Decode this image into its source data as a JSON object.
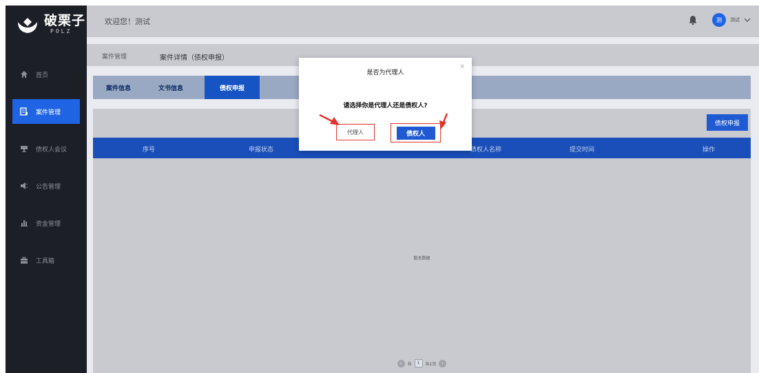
{
  "brand": {
    "name": "破栗子",
    "sub": "POLZ"
  },
  "sidebar": {
    "items": [
      {
        "label": "首页",
        "icon": "home-icon"
      },
      {
        "label": "案件管理",
        "icon": "case-icon"
      },
      {
        "label": "债权人会议",
        "icon": "meeting-icon"
      },
      {
        "label": "公告管理",
        "icon": "megaphone-icon"
      },
      {
        "label": "资金管理",
        "icon": "chart-icon"
      },
      {
        "label": "工具箱",
        "icon": "toolbox-icon"
      }
    ],
    "active": "案件管理"
  },
  "header": {
    "welcome": "欢迎您！测试",
    "avatar_text": "测",
    "username": "测试"
  },
  "breadcrumb": {
    "parent": "案件管理",
    "current": "案件详情（债权申报）"
  },
  "tabs": [
    {
      "label": "案件信息"
    },
    {
      "label": "文书信息"
    },
    {
      "label": "债权申报"
    }
  ],
  "toolbar": {
    "report_label": "债权申报"
  },
  "table": {
    "columns": [
      "序号",
      "申报状态",
      "债权人名称",
      "提交时间",
      "操作"
    ],
    "empty_text": "暂无数据"
  },
  "pagination": {
    "total_prefix": "共",
    "page": "1",
    "total_pages": "共1页"
  },
  "modal": {
    "title": "是否为代理人",
    "close": "×",
    "message": "请选择你是代理人还是债权人?",
    "agent_label": "代理人",
    "creditor_label": "债权人"
  },
  "colors": {
    "accent": "#1f5ad3",
    "annotation": "#e3322b",
    "sidebar": "#1c1f25"
  }
}
